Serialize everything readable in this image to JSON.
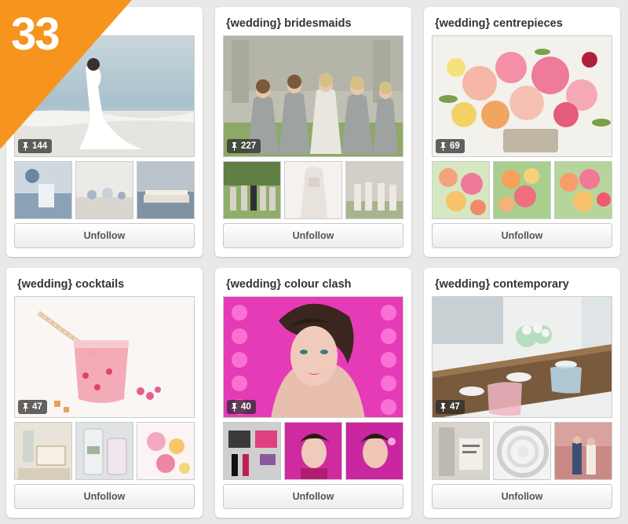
{
  "rank": {
    "number": "33",
    "color": "#f7941d"
  },
  "boards": [
    {
      "title": "",
      "pins": "144",
      "unfollow_label": "Unfollow"
    },
    {
      "title": "{wedding} bridesmaids",
      "pins": "227",
      "unfollow_label": "Unfollow"
    },
    {
      "title": "{wedding} centrepieces",
      "pins": "69",
      "unfollow_label": "Unfollow"
    },
    {
      "title": "{wedding} cocktails",
      "pins": "47",
      "unfollow_label": "Unfollow"
    },
    {
      "title": "{wedding} colour clash",
      "pins": "40",
      "unfollow_label": "Unfollow"
    },
    {
      "title": "{wedding} contemporary",
      "pins": "47",
      "unfollow_label": "Unfollow"
    }
  ],
  "icons": {
    "pin": "pin-icon"
  }
}
